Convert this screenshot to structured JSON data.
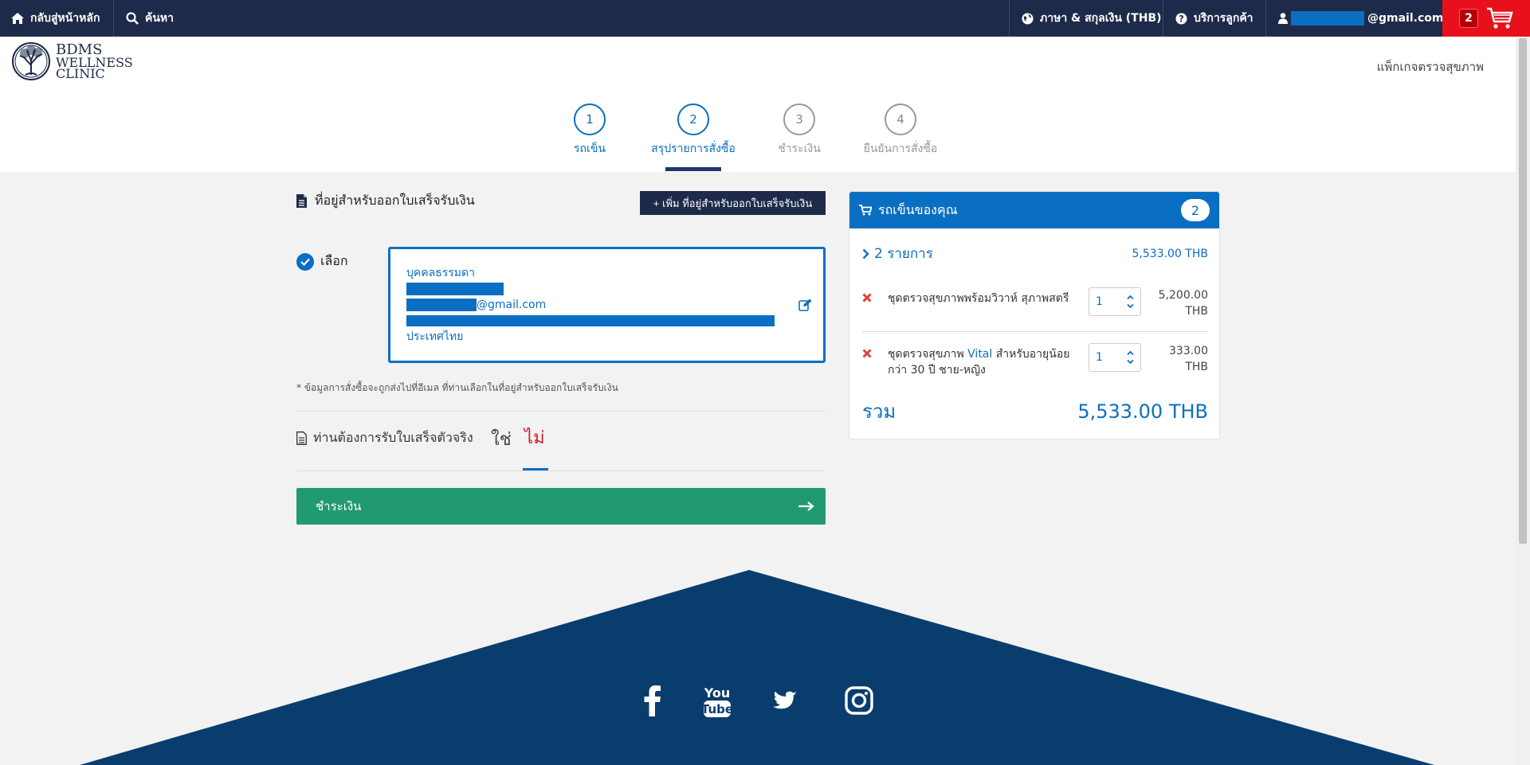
{
  "topnav": {
    "home_label": "กลับสู่หน้าหลัก",
    "search_label": "ค้นหา",
    "lang_label": "ภาษา & สกุลเงิน (THB)",
    "service_label": "บริการลูกค้า",
    "email_suffix": "@gmail.com",
    "cart_count": "2"
  },
  "header": {
    "logo_line1": "BDMS",
    "logo_line2": "WELLNESS",
    "logo_line3": "CLINIC",
    "packages_link": "แพ็กเกจตรวจสุขภาพ"
  },
  "steps": [
    {
      "num": "1",
      "label": "รถเข็น"
    },
    {
      "num": "2",
      "label": "สรุปรายการสั่งซื้อ"
    },
    {
      "num": "3",
      "label": "ชำระเงิน"
    },
    {
      "num": "4",
      "label": "ยืนยันการสั่งซื้อ"
    }
  ],
  "billing": {
    "title": "ที่อยู่สำหรับออกใบเสร็จรับเงิน",
    "add_button": "+ เพิ่ม ที่อยู่สำหรับออกใบเสร็จรับเงิน",
    "select_label": "เลือก",
    "type": "บุคคลธรรมดา",
    "email_suffix": "@gmail.com",
    "country": "ประเทศไทย",
    "note": "* ข้อมูลการสั่งซื้อจะถูกส่งไปที่อีเมล ที่ท่านเลือกในที่อยู่สำหรับออกใบเสร็จรับเงิน"
  },
  "invoice": {
    "question": "ท่านต้องการรับใบเสร็จตัวจริง",
    "yes": "ใช่",
    "no": "ไม่"
  },
  "pay_button": "ชำระเงิน",
  "cart": {
    "title": "รถเข็นของคุณ",
    "count": "2",
    "summary_label": "2 รายการ",
    "summary_amount": "5,533.00 THB",
    "items": [
      {
        "name": "ชุดตรวจสุขภาพพร้อมวิวาห์ สุภาพสตรี",
        "name_prefix": "",
        "name_highlight": "",
        "name_suffix": "",
        "qty": "1",
        "price": "5,200.00 THB"
      },
      {
        "name_prefix": "ชุดตรวจสุขภาพ ",
        "name_highlight": "Vital",
        "name_suffix": " สำหรับอายุน้อยกว่า 30 ปี ชาย-หญิง",
        "qty": "1",
        "price": "333.00 THB"
      }
    ],
    "total_label": "รวม",
    "total_amount": "5,533.00 THB"
  },
  "colors": {
    "nav": "#1e2a4a",
    "accent": "#0a6fc2",
    "pay": "#229a70",
    "cart_red": "#e8101a",
    "no_red": "#d0212a"
  },
  "icons": [
    "home-icon",
    "search-icon",
    "globe-icon",
    "question-icon",
    "user-icon",
    "cart-icon",
    "document-icon",
    "check-icon",
    "edit-icon",
    "remove-icon",
    "chevron-right-icon",
    "arrow-right-icon",
    "facebook-icon",
    "youtube-icon",
    "twitter-icon",
    "instagram-icon"
  ]
}
